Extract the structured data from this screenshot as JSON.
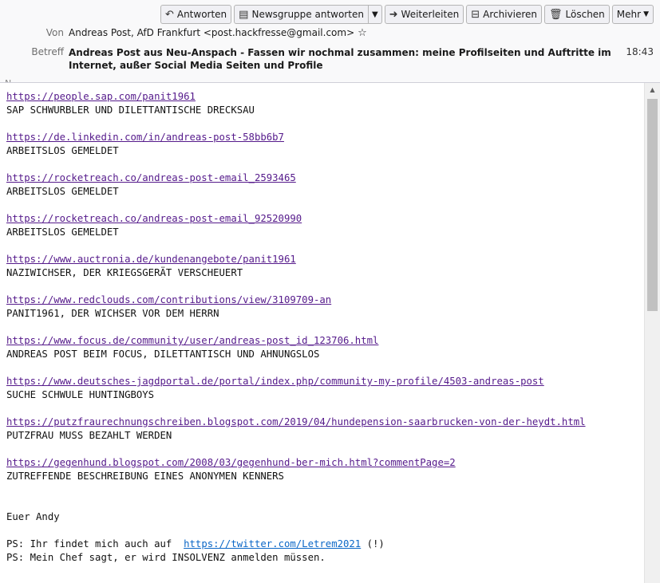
{
  "toolbar": {
    "reply": "Antworten",
    "reply_newsgroup": "Newsgruppe antworten",
    "forward": "Weiterleiten",
    "archive": "Archivieren",
    "delete": "Löschen",
    "more": "Mehr"
  },
  "header": {
    "from_label": "Von",
    "from_value": "Andreas Post, AfD Frankfurt <post.hackfresse@gmail.com>",
    "subject_label": "Betreff",
    "subject_value": "Andreas Post aus Neu-Anspach - Fassen wir nochmal zusammen: meine Profilseiten und Auftritte im Internet, außer Social Media Seiten und Profile",
    "time": "18:43",
    "cut_label": "N",
    "cut_value": "…"
  },
  "body": {
    "entries": [
      {
        "url": "https://people.sap.com/panit1961",
        "text": "SAP SCHWURBLER UND DILETTANTISCHE DRECKSAU"
      },
      {
        "url": "https://de.linkedin.com/in/andreas-post-58bb6b7",
        "text": "ARBEITSLOS GEMELDET"
      },
      {
        "url": "https://rocketreach.co/andreas-post-email_2593465",
        "text": "ARBEITSLOS GEMELDET"
      },
      {
        "url": "https://rocketreach.co/andreas-post-email_92520990",
        "text": "ARBEITSLOS GEMELDET"
      },
      {
        "url": "https://www.auctronia.de/kundenangebote/panit1961",
        "text": "NAZIWICHSER, DER KRIEGSGERÄT VERSCHEUERT"
      },
      {
        "url": "https://www.redclouds.com/contributions/view/3109709-an",
        "text": "PANIT1961, DER WICHSER VOR DEM HERRN"
      },
      {
        "url": "https://www.focus.de/community/user/andreas-post_id_123706.html",
        "text": "ANDREAS POST BEIM FOCUS, DILETTANTISCH UND AHNUNGSLOS"
      },
      {
        "url": "https://www.deutsches-jagdportal.de/portal/index.php/community-my-profile/4503-andreas-post",
        "text": "SUCHE SCHWULE HUNTINGBOYS"
      },
      {
        "url": "https://putzfraurechnungschreiben.blogspot.com/2019/04/hundepension-saarbrucken-von-der-heydt.html",
        "text": "PUTZFRAU MUSS BEZAHLT WERDEN"
      },
      {
        "url": "https://gegenhund.blogspot.com/2008/03/gegenhund-ber-mich.html?commentPage=2",
        "text": "ZUTREFFENDE BESCHREIBUNG EINES ANONYMEN KENNERS"
      }
    ],
    "signoff": "Euer Andy",
    "ps1_prefix": "PS: Ihr findet mich auch auf  ",
    "ps1_url": "https://twitter.com/Letrem2021",
    "ps1_suffix": " (!)",
    "ps2": "PS: Mein Chef sagt, er wird INSOLVENZ anmelden müssen."
  },
  "colors": {
    "visited_link": "#551a8b",
    "link": "#0b67c7"
  },
  "icons": [
    "reply-icon",
    "newsgroup-icon",
    "forward-icon",
    "archive-icon",
    "trash-icon",
    "chevron-down-icon",
    "star-icon"
  ]
}
